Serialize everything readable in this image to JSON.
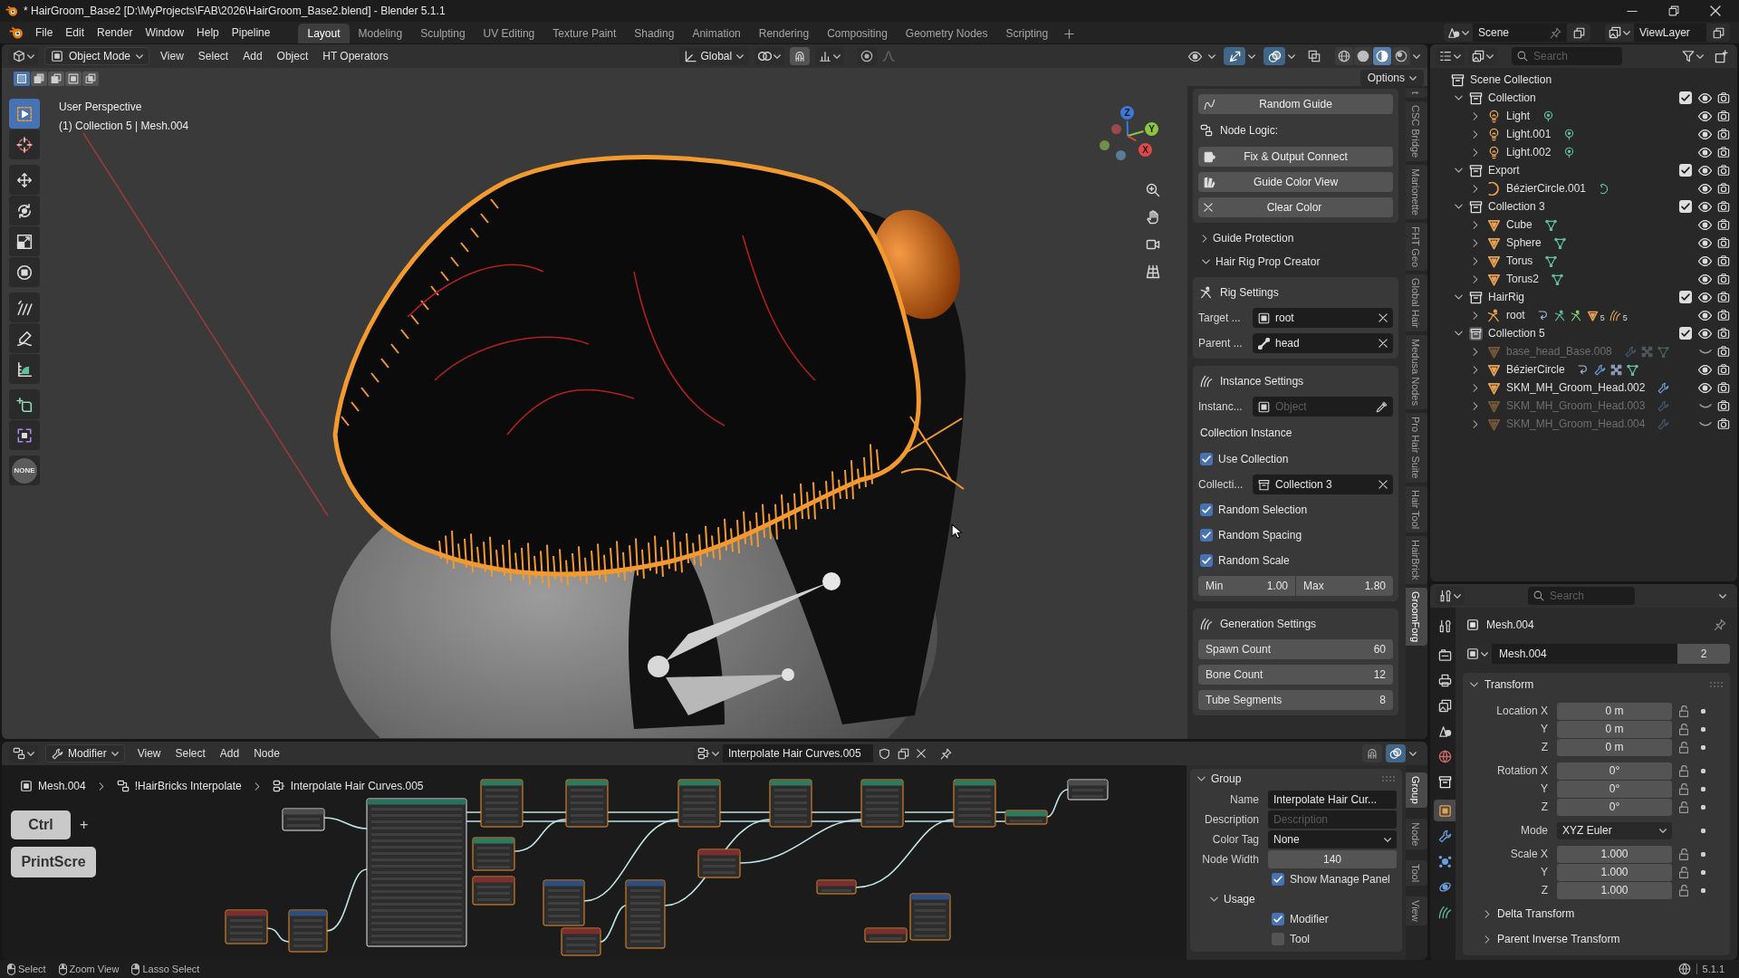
{
  "window": {
    "title": "* HairGroom_Base2 [D:\\MyProjects\\FAB\\2026\\HairGroom_Base2.blend] - Blender 5.1.1"
  },
  "menu": [
    "File",
    "Edit",
    "Render",
    "Window",
    "Help",
    "Pipeline"
  ],
  "workspaces": [
    {
      "label": "Layout",
      "selected": true
    },
    {
      "label": "Modeling",
      "selected": false
    },
    {
      "label": "Sculpting",
      "selected": false
    },
    {
      "label": "UV Editing",
      "selected": false
    },
    {
      "label": "Texture Paint",
      "selected": false
    },
    {
      "label": "Shading",
      "selected": false
    },
    {
      "label": "Animation",
      "selected": false
    },
    {
      "label": "Rendering",
      "selected": false
    },
    {
      "label": "Compositing",
      "selected": false
    },
    {
      "label": "Geometry Nodes",
      "selected": false
    },
    {
      "label": "Scripting",
      "selected": false
    }
  ],
  "scene": {
    "name": "Scene",
    "view_layer": "ViewLayer"
  },
  "viewport": {
    "mode": "Object Mode",
    "menus": [
      "View",
      "Select",
      "Add",
      "Object",
      "HT Operators"
    ],
    "orientation": "Global",
    "toggles": [
      {
        "kind": "visibility",
        "on": false
      },
      {
        "kind": "gizmos",
        "on": true
      },
      {
        "kind": "overlays",
        "on": true
      },
      {
        "kind": "xray",
        "on": false
      }
    ],
    "shading": [
      {
        "kind": "wireframe",
        "selected": false
      },
      {
        "kind": "solid",
        "selected": false
      },
      {
        "kind": "material",
        "selected": true
      },
      {
        "kind": "rendered",
        "selected": false
      }
    ],
    "select_modes": [
      {
        "kind": "set",
        "selected": true
      },
      {
        "kind": "extend",
        "selected": false
      },
      {
        "kind": "subtract",
        "selected": false
      },
      {
        "kind": "invert",
        "selected": false
      },
      {
        "kind": "intersect",
        "selected": false
      }
    ],
    "tool_groups": [
      [
        {
          "kind": "select-box",
          "selected": true
        },
        {
          "kind": "cursor",
          "selected": false
        }
      ],
      [
        {
          "kind": "move",
          "selected": false
        },
        {
          "kind": "rotate",
          "selected": false
        },
        {
          "kind": "scale",
          "selected": false
        },
        {
          "kind": "transform",
          "selected": false
        }
      ],
      [
        {
          "kind": "annotate",
          "selected": false
        },
        {
          "kind": "draw",
          "selected": false
        },
        {
          "kind": "measure",
          "selected": false
        }
      ],
      [
        {
          "kind": "add-cube",
          "selected": false
        },
        {
          "kind": "custom",
          "selected": false
        }
      ],
      [
        {
          "kind": "disc",
          "label": "NONE",
          "selected": false
        }
      ]
    ],
    "info": [
      "User Perspective",
      "(1) Collection 5 | Mesh.004"
    ],
    "gizmo_axes": [
      "X",
      "Y",
      "Z"
    ],
    "options": "Options",
    "sidebar": {
      "tabs": [
        {
          "label": "t",
          "selected": false
        },
        {
          "label": "CSC Bridge",
          "selected": false
        },
        {
          "label": "Marionette",
          "selected": false
        },
        {
          "label": "FHT Geo",
          "selected": false
        },
        {
          "label": "Global Hair",
          "selected": false
        },
        {
          "label": "Medusa Nodes",
          "selected": false
        },
        {
          "label": "Pro Hair Suite",
          "selected": false
        },
        {
          "label": "Hair Tool",
          "selected": false
        },
        {
          "label": "HairBrick",
          "selected": false
        },
        {
          "label": "GroomForg",
          "selected": true
        }
      ],
      "blocks": [
        {
          "kind": "box",
          "rows": [
            {
              "kind": "button",
              "label": "Random Guide"
            },
            {
              "kind": "heading",
              "label": "Node Logic:"
            },
            {
              "kind": "button",
              "label": "Fix & Output Connect"
            },
            {
              "kind": "button",
              "label": "Guide Color View"
            },
            {
              "kind": "button",
              "label": "Clear Color"
            }
          ]
        },
        {
          "kind": "subpanel",
          "label": "Guide Protection",
          "expanded": false
        },
        {
          "kind": "subpanel",
          "label": "Hair Rig Prop Creator",
          "expanded": true
        },
        {
          "kind": "box",
          "title": "Rig Settings",
          "rows": [
            {
              "kind": "field",
              "label": "Target ...",
              "value": "root",
              "action": {
                "kind": "clear"
              }
            },
            {
              "kind": "field",
              "label": "Parent ...",
              "value": "head",
              "action": {
                "kind": "clear"
              }
            }
          ]
        },
        {
          "kind": "box",
          "title": "Instance Settings",
          "rows": [
            {
              "kind": "field",
              "label": "Instanc...",
              "placeholder": "Object",
              "action": {
                "kind": "eyedropper"
              }
            },
            {
              "kind": "heading",
              "label": "Collection Instance"
            },
            {
              "kind": "checkbox",
              "label": "Use Collection",
              "checked": true
            },
            {
              "kind": "field",
              "label": "Collecti...",
              "value": "Collection 3",
              "action": {
                "kind": "clear"
              }
            },
            {
              "kind": "checkbox",
              "label": "Random Selection",
              "checked": true
            },
            {
              "kind": "checkbox",
              "label": "Random Spacing",
              "checked": true
            },
            {
              "kind": "checkbox",
              "label": "Random Scale",
              "checked": true
            },
            {
              "kind": "range",
              "fields": [
                {
                  "label": "Min",
                  "value": "1.00"
                },
                {
                  "label": "Max",
                  "value": "1.80"
                }
              ]
            }
          ]
        },
        {
          "kind": "box",
          "title": "Generation Settings",
          "rows": [
            {
              "kind": "number",
              "label": "Spawn Count",
              "value": "60"
            },
            {
              "kind": "number",
              "label": "Bone Count",
              "value": "12"
            },
            {
              "kind": "number",
              "label": "Tube Segments",
              "value": "8"
            }
          ]
        }
      ]
    }
  },
  "outliner": {
    "search": {
      "placeholder": "Search"
    },
    "tree": [
      {
        "name": "Scene Collection",
        "kind": "scene-collection",
        "children": [
          {
            "name": "Collection",
            "kind": "collection",
            "expanded": true,
            "checked": true,
            "active": false,
            "visible": true,
            "children": [
              {
                "name": "Light",
                "kind": "light",
                "expanded": false,
                "visible": true,
                "extras": [
                  {
                    "kind": "light-data"
                  }
                ]
              },
              {
                "name": "Light.001",
                "kind": "light",
                "expanded": false,
                "visible": true,
                "extras": [
                  {
                    "kind": "light-data"
                  }
                ]
              },
              {
                "name": "Light.002",
                "kind": "light",
                "expanded": false,
                "visible": true,
                "extras": [
                  {
                    "kind": "light-data"
                  }
                ]
              }
            ]
          },
          {
            "name": "Export",
            "kind": "collection",
            "expanded": true,
            "checked": true,
            "active": false,
            "visible": true,
            "children": [
              {
                "name": "BézierCircle.001",
                "kind": "curve",
                "expanded": false,
                "visible": true,
                "extras": [
                  {
                    "kind": "curve-data"
                  }
                ]
              }
            ]
          },
          {
            "name": "Collection 3",
            "kind": "collection",
            "expanded": true,
            "checked": true,
            "active": false,
            "visible": true,
            "children": [
              {
                "name": "Cube",
                "kind": "mesh",
                "expanded": false,
                "visible": true,
                "extras": [
                  {
                    "kind": "mesh-data"
                  }
                ]
              },
              {
                "name": "Sphere",
                "kind": "mesh",
                "expanded": false,
                "visible": true,
                "extras": [
                  {
                    "kind": "mesh-data"
                  }
                ]
              },
              {
                "name": "Torus",
                "kind": "mesh",
                "expanded": false,
                "visible": true,
                "extras": [
                  {
                    "kind": "mesh-data"
                  }
                ]
              },
              {
                "name": "Torus2",
                "kind": "mesh",
                "expanded": false,
                "visible": true,
                "extras": [
                  {
                    "kind": "mesh-data"
                  }
                ]
              }
            ]
          },
          {
            "name": "HairRig",
            "kind": "collection",
            "expanded": true,
            "checked": true,
            "active": false,
            "visible": true,
            "children": [
              {
                "name": "root",
                "kind": "armature",
                "expanded": false,
                "visible": true,
                "extras": [
                  {
                    "kind": "constraint"
                  },
                  {
                    "kind": "pose"
                  },
                  {
                    "kind": "armature-data"
                  },
                  {
                    "kind": "mesh",
                    "count": "5"
                  },
                  {
                    "kind": "hair",
                    "count": "5"
                  }
                ]
              }
            ]
          },
          {
            "name": "Collection 5",
            "kind": "collection",
            "expanded": true,
            "checked": true,
            "active": true,
            "visible": true,
            "children": [
              {
                "name": "base_head_Base.008",
                "kind": "mesh",
                "expanded": false,
                "visible": false,
                "extras": [
                  {
                    "kind": "modifier"
                  },
                  {
                    "kind": "geometry-nodes"
                  },
                  {
                    "kind": "mesh-data"
                  }
                ]
              },
              {
                "name": "BézierCircle",
                "kind": "mesh",
                "expanded": false,
                "visible": true,
                "extras": [
                  {
                    "kind": "constraint"
                  },
                  {
                    "kind": "modifier"
                  },
                  {
                    "kind": "geometry-nodes"
                  },
                  {
                    "kind": "mesh-data"
                  }
                ]
              },
              {
                "name": "SKM_MH_Groom_Head.002",
                "kind": "mesh",
                "expanded": false,
                "visible": true,
                "extras": [
                  {
                    "kind": "modifier"
                  }
                ]
              },
              {
                "name": "SKM_MH_Groom_Head.003",
                "kind": "mesh",
                "expanded": false,
                "visible": false,
                "extras": [
                  {
                    "kind": "modifier"
                  }
                ]
              },
              {
                "name": "SKM_MH_Groom_Head.004",
                "kind": "mesh",
                "expanded": false,
                "visible": false,
                "extras": [
                  {
                    "kind": "modifier"
                  }
                ]
              }
            ]
          }
        ]
      }
    ]
  },
  "properties": {
    "search": {
      "placeholder": "Search"
    },
    "tab_groups": [
      [
        {
          "kind": "tool",
          "selected": false
        }
      ],
      [
        {
          "kind": "render",
          "selected": false
        },
        {
          "kind": "output",
          "selected": false
        },
        {
          "kind": "view-layer",
          "selected": false
        },
        {
          "kind": "scene",
          "selected": false
        },
        {
          "kind": "world",
          "selected": false
        },
        {
          "kind": "collection",
          "selected": false
        }
      ],
      [
        {
          "kind": "object",
          "selected": true
        },
        {
          "kind": "modifiers",
          "selected": false
        },
        {
          "kind": "particles",
          "selected": false
        },
        {
          "kind": "physics",
          "selected": false
        },
        {
          "kind": "data",
          "selected": false
        }
      ]
    ],
    "title": "Mesh.004",
    "name": "Mesh.004",
    "users": "2",
    "transform": {
      "label": "Transform",
      "expanded": true,
      "groups": [
        [
          {
            "kind": "number",
            "label": "Location X",
            "value": "0 m"
          },
          {
            "kind": "number",
            "label": "Y",
            "value": "0 m"
          },
          {
            "kind": "number",
            "label": "Z",
            "value": "0 m"
          }
        ],
        [
          {
            "kind": "number",
            "label": "Rotation X",
            "value": "0°"
          },
          {
            "kind": "number",
            "label": "Y",
            "value": "0°"
          },
          {
            "kind": "number",
            "label": "Z",
            "value": "0°"
          }
        ],
        [
          {
            "kind": "dropdown",
            "label": "Mode",
            "value": "XYZ Euler"
          }
        ],
        [
          {
            "kind": "number",
            "label": "Scale X",
            "value": "1.000"
          },
          {
            "kind": "number",
            "label": "Y",
            "value": "1.000"
          },
          {
            "kind": "number",
            "label": "Z",
            "value": "1.000"
          }
        ]
      ],
      "subpanels": [
        {
          "label": "Delta Transform",
          "expanded": false
        },
        {
          "label": "Parent Inverse Transform",
          "expanded": false
        }
      ]
    }
  },
  "node_editor": {
    "mode": "Modifier",
    "menus": [
      "View",
      "Select",
      "Add",
      "Node"
    ],
    "node_group": "Interpolate Hair Curves.005",
    "toggles": [
      {
        "kind": "snap",
        "on": false
      },
      {
        "kind": "overlays",
        "on": true
      }
    ],
    "breadcrumbs": [
      {
        "kind": "object",
        "label": "Mesh.004"
      },
      {
        "kind": "modifier",
        "label": "!HairBricks Interpolate"
      },
      {
        "kind": "node-group",
        "label": "Interpolate Hair Curves.005"
      }
    ],
    "keys": {
      "items": [
        "Ctrl",
        "PrintScre"
      ],
      "separator": "+"
    },
    "sidebar": {
      "tabs": [
        {
          "label": "Group",
          "selected": true
        },
        {
          "label": "Node",
          "selected": false
        },
        {
          "label": "Tool",
          "selected": false
        },
        {
          "label": "View",
          "selected": false
        }
      ],
      "panel": {
        "label": "Group",
        "expanded": true,
        "rows": [
          {
            "kind": "text",
            "label": "Name",
            "value": "Interpolate Hair Cur..."
          },
          {
            "kind": "text",
            "label": "Description",
            "placeholder": "Description"
          },
          {
            "kind": "dropdown",
            "label": "Color Tag",
            "value": "None"
          },
          {
            "kind": "number",
            "label": "Node Width",
            "value": "140"
          },
          {
            "kind": "checkbox",
            "label": "Show Manage Panel",
            "checked": true
          }
        ],
        "subpanels": [
          {
            "label": "Usage",
            "expanded": true,
            "rows": [
              {
                "kind": "checkbox",
                "label": "Modifier",
                "checked": true
              },
              {
                "kind": "checkbox",
                "label": "Tool",
                "checked": false
              }
            ]
          }
        ]
      }
    }
  },
  "status_bar": {
    "hints": [
      {
        "kind": "left-click",
        "label": "Select"
      },
      {
        "kind": "middle-click",
        "label": "Zoom View"
      },
      {
        "kind": "right-click",
        "label": "Lasso Select"
      }
    ],
    "version": "5.1.1"
  }
}
